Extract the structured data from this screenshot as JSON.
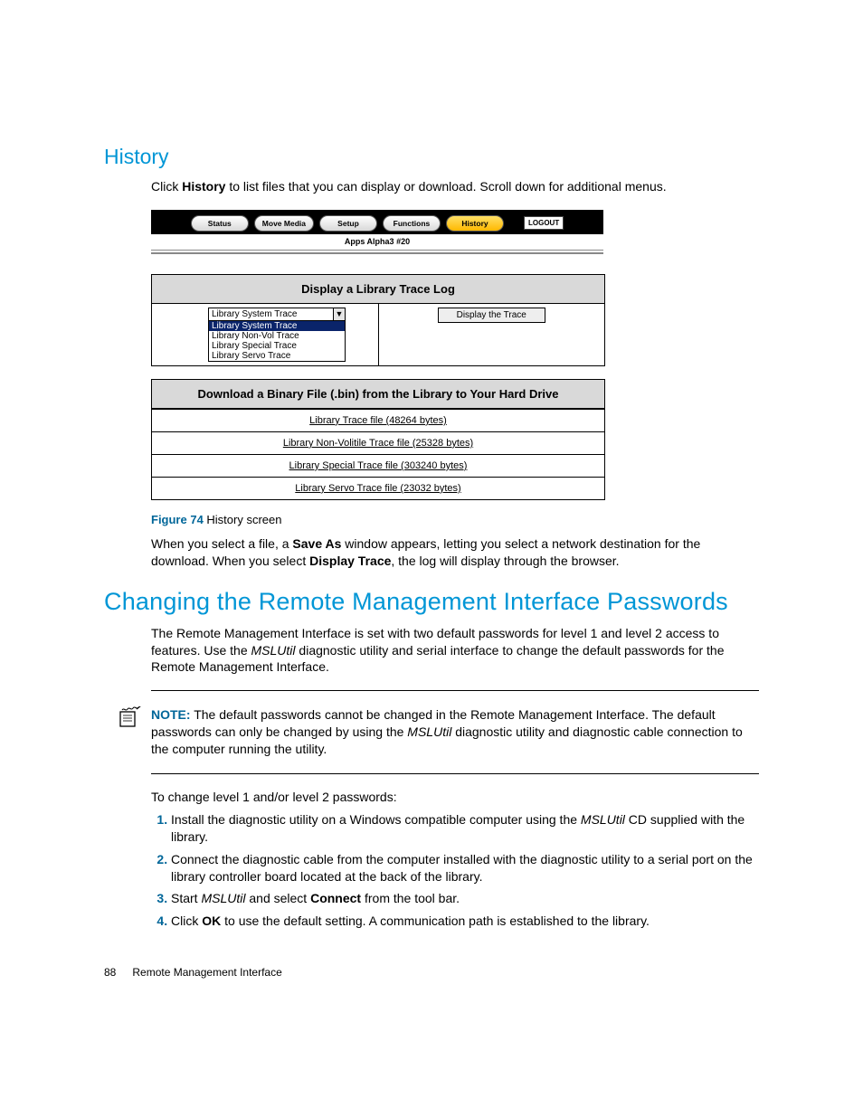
{
  "section1": {
    "title": "History",
    "intro_1": "Click ",
    "intro_bold": "History",
    "intro_2": " to list files that you can display or download. Scroll down for additional menus."
  },
  "fig": {
    "nav": {
      "status": "Status",
      "move_media": "Move Media",
      "setup": "Setup",
      "functions": "Functions",
      "history": "History",
      "logout": "LOGOUT"
    },
    "subtitle": "Apps Alpha3 #20",
    "trace_panel": {
      "header": "Display a Library Trace Log",
      "selected": "Library System Trace",
      "options": [
        "Library System Trace",
        "Library Non-Vol Trace",
        "Library Special Trace",
        "Library Servo Trace"
      ],
      "button": "Display the Trace"
    },
    "download_panel": {
      "header": "Download a Binary File (.bin) from the Library to Your Hard Drive",
      "rows": [
        "Library Trace file (48264 bytes)",
        "Library Non-Volitile Trace file (25328 bytes)",
        "Library Special Trace file (303240 bytes)",
        "Library Servo Trace file (23032 bytes)"
      ]
    },
    "caption_label": "Figure 74",
    "caption_text": " History screen"
  },
  "para_after_fig": {
    "t1": "When you select a file, a ",
    "b1": "Save As",
    "t2": " window appears, letting you select a network destination for the download. When you select ",
    "b2": "Display Trace",
    "t3": ", the log will display through the browser."
  },
  "section2": {
    "title": "Changing the Remote Management Interface Passwords",
    "para_a": "The Remote Management Interface is set with two default passwords for level 1 and level 2 access to features. Use the ",
    "para_em": "MSLUtil",
    "para_b": " diagnostic utility and serial interface to change the default passwords for the Remote Management Interface."
  },
  "note": {
    "label": "NOTE:",
    "t1": "   The default passwords cannot be changed in the Remote Management Interface. The default passwords can only be changed by using the ",
    "em": "MSLUtil",
    "t2": " diagnostic utility and diagnostic cable connection to the computer running the utility."
  },
  "steps_intro": "To change level 1 and/or level 2 passwords:",
  "steps": {
    "s1a": "Install the diagnostic utility on a Windows compatible computer using the ",
    "s1em": "MSLUtil",
    "s1b": " CD supplied with the library.",
    "s2": "Connect the diagnostic cable from the computer installed with the diagnostic utility to a serial port on the library controller board located at the back of the library.",
    "s3a": "Start ",
    "s3em": "MSLUtil",
    "s3b": " and select ",
    "s3bold": "Connect",
    "s3c": " from the tool bar.",
    "s4a": "Click ",
    "s4bold": "OK",
    "s4b": " to use the default setting. A communication path is established to the library."
  },
  "footer": {
    "page": "88",
    "chapter": "Remote Management Interface"
  }
}
